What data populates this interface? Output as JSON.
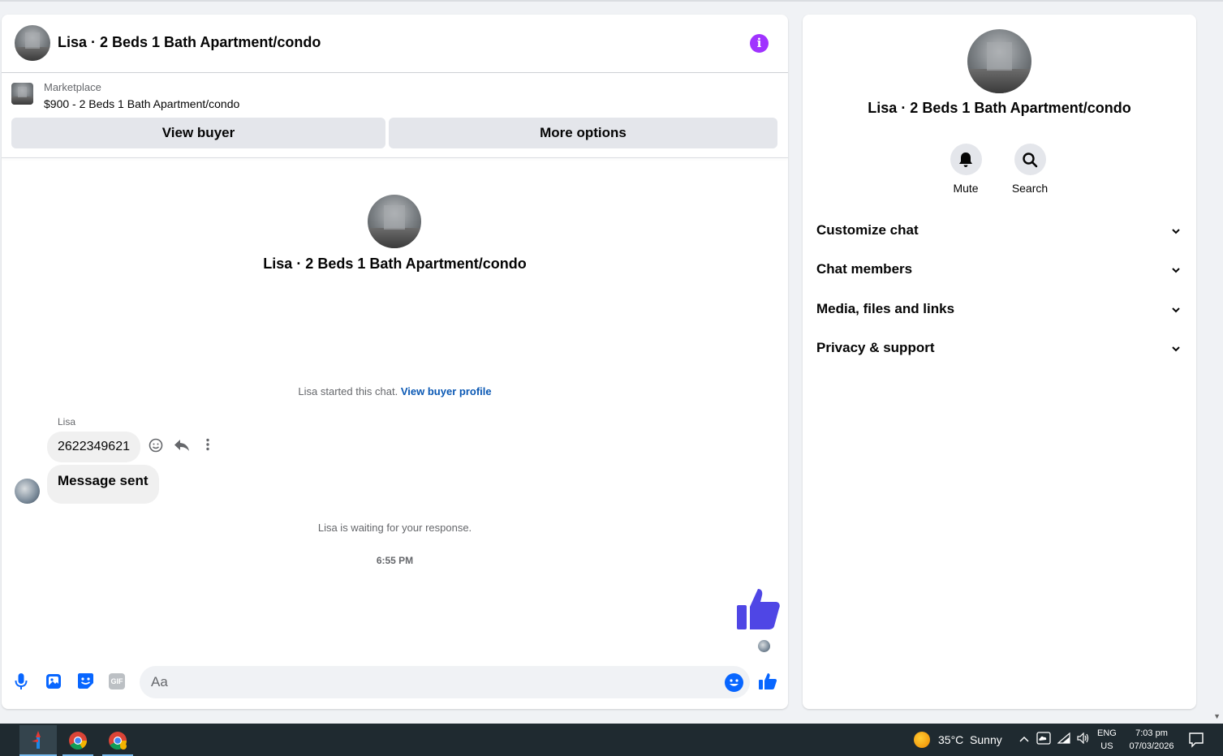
{
  "chat": {
    "header_title": "Lisa · 2 Beds 1 Bath Apartment/condo",
    "marketplace_label": "Marketplace",
    "listing": "$900 - 2 Beds 1 Bath Apartment/condo",
    "view_buyer": "View buyer",
    "more_options": "More options",
    "center_title": "Lisa · 2 Beds 1 Bath Apartment/condo",
    "started_text": "Lisa started this chat.",
    "view_profile": "View buyer profile",
    "sender_name": "Lisa",
    "messages": [
      "2622349621",
      "Message sent"
    ],
    "waiting": "Lisa is waiting for your response.",
    "timestamp": "6:55 PM",
    "composer_placeholder": "Aa"
  },
  "info_panel": {
    "title": "Lisa · 2 Beds 1 Bath Apartment/condo",
    "mute": "Mute",
    "search": "Search",
    "sections": [
      "Customize chat",
      "Chat members",
      "Media, files and links",
      "Privacy & support"
    ]
  },
  "taskbar": {
    "weather": "35°C  Sunny",
    "lang_top": "ENG",
    "lang_bottom": "US",
    "time": "7:03 pm",
    "date": "07/03/2026"
  },
  "colors": {
    "messenger_blue": "#0866ff",
    "info_purple": "#a033ff",
    "like_purple": "#4f46e5"
  }
}
